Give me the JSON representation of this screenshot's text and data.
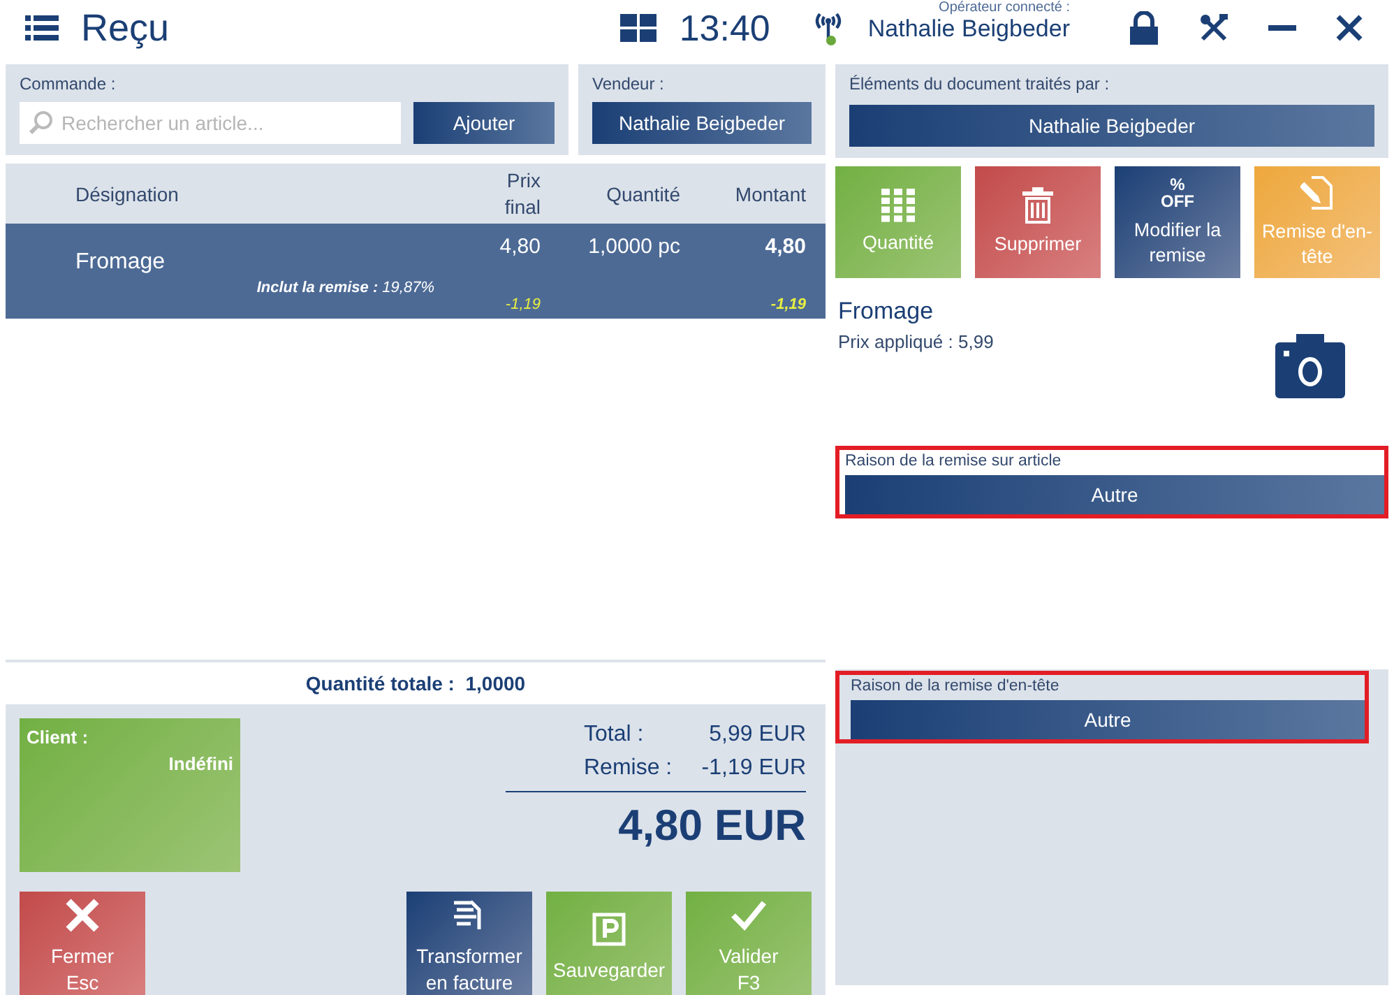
{
  "header": {
    "title": "Reçu",
    "time": "13:40",
    "operator_label": "Opérateur connecté :",
    "operator_name": "Nathalie Beigbeder"
  },
  "order": {
    "label": "Commande :",
    "placeholder": "Rechercher un article...",
    "add_button": "Ajouter"
  },
  "seller": {
    "label": "Vendeur :",
    "value": "Nathalie Beigbeder"
  },
  "processed_by": {
    "label": "Éléments du document traités par :",
    "value": "Nathalie Beigbeder"
  },
  "table": {
    "columns": [
      "Désignation",
      "Prix final",
      "Quantité",
      "Montant"
    ],
    "rows": [
      {
        "designation": "Fromage",
        "discount_label": "Inclut la remise :",
        "discount_value": "19,87%",
        "price": "4,80",
        "price_discount": "-1,19",
        "quantity": "1,0000 pc",
        "amount": "4,80",
        "amount_discount": "-1,19",
        "selected": true
      }
    ]
  },
  "total_quantity": {
    "label": "Quantité totale :",
    "value": "1,0000"
  },
  "client": {
    "label": "Client :",
    "value": "Indéfini"
  },
  "totals": {
    "total_label": "Total :",
    "total_value": "5,99 EUR",
    "discount_label": "Remise :",
    "discount_value": "-1,19 EUR",
    "grand_total": "4,80 EUR"
  },
  "bottom_buttons": [
    {
      "kind": "close",
      "lines": [
        "Fermer",
        "Esc"
      ]
    },
    {
      "kind": "invoice",
      "lines": [
        "Transformer",
        "en facture"
      ]
    },
    {
      "kind": "save",
      "lines": [
        "Sauvegarder"
      ]
    },
    {
      "kind": "validate",
      "lines": [
        "Valider",
        "F3"
      ]
    }
  ],
  "action_tiles": [
    {
      "kind": "quantity",
      "label": "Quantité"
    },
    {
      "kind": "delete",
      "label": "Supprimer"
    },
    {
      "kind": "discount",
      "label": "Modifier la remise",
      "icon_lines": [
        "%",
        "OFF"
      ]
    },
    {
      "kind": "header_discount",
      "label": "Remise d'en-tête"
    }
  ],
  "product": {
    "name": "Fromage",
    "applied_price": "Prix appliqué : 5,99"
  },
  "reasons": [
    {
      "kind": "item",
      "label": "Raison de la remise sur article",
      "value": "Autre",
      "highlighted": true
    },
    {
      "kind": "header",
      "label": "Raison de la remise d'en-tête",
      "value": "Autre",
      "highlighted": true
    }
  ]
}
